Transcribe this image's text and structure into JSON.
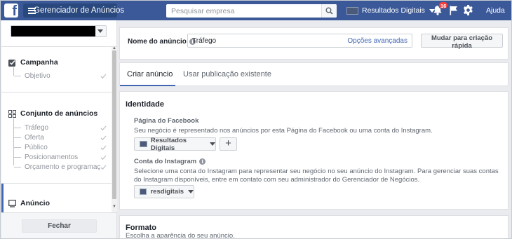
{
  "topbar": {
    "app_title": "Gerenciador de Anúncios",
    "search_placeholder": "Pesquisar empresa",
    "account_name": "Resultados Digitais",
    "notification_count": "16",
    "help_label": "Ajuda",
    "bar_color": "#3b5998"
  },
  "sidebar": {
    "campaign": {
      "title": "Campanha",
      "steps": [
        "Objetivo"
      ]
    },
    "adset": {
      "title": "Conjunto de anúncios",
      "steps": [
        "Tráfego",
        "Oferta",
        "Público",
        "Posicionamentos",
        "Orçamento e programação"
      ]
    },
    "ad": {
      "title": "Anúncio"
    },
    "close_label": "Fechar"
  },
  "ad_name": {
    "label": "Nome do anúncio",
    "value": "Tráfego",
    "advanced_link": "Opções avançadas",
    "quick_button": "Mudar para criação rápida"
  },
  "tabs": {
    "create": "Criar anúncio",
    "existing": "Usar publicação existente"
  },
  "identity": {
    "title": "Identidade",
    "facebook_page": {
      "label": "Página do Facebook",
      "help": "Seu negócio é representado nos anúncios por esta Página do Facebook ou uma conta do Instagram.",
      "selected": "Resultados Digitais"
    },
    "instagram": {
      "label": "Conta do Instagram",
      "help": "Selecione uma conta do Instagram para representar seu negócio no seu anúncio do Instagram. Para gerenciar suas contas do Instagram disponíveis, entre em contato com seu administrador do Gerenciador de Negócios.",
      "selected": "resdigitais"
    }
  },
  "format": {
    "title": "Formato",
    "help": "Escolha a aparência do seu anúncio."
  },
  "accent_color": "#4267b2"
}
